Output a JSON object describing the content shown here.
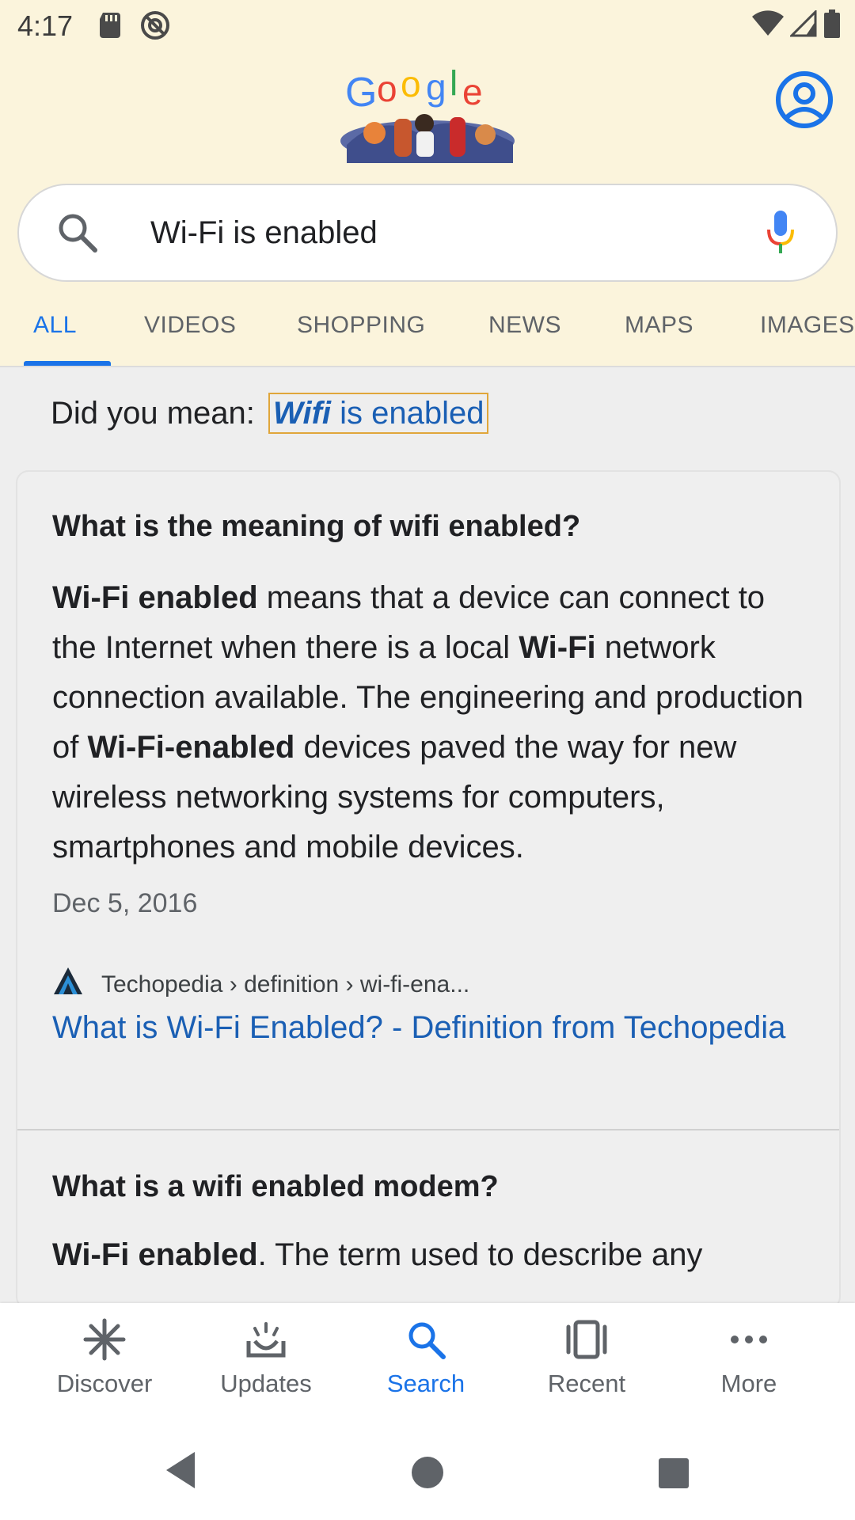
{
  "status_bar": {
    "time": "4:17"
  },
  "search": {
    "query": "Wi-Fi is enabled"
  },
  "tabs": [
    "ALL",
    "VIDEOS",
    "SHOPPING",
    "NEWS",
    "MAPS",
    "IMAGES"
  ],
  "active_tab": "ALL",
  "did_you_mean": {
    "label": "Did you mean:",
    "suggestion_bold": "Wifi",
    "suggestion_rest": " is enabled"
  },
  "result1": {
    "question": "What is the meaning of wifi enabled?",
    "seg1_b": "Wi-Fi enabled",
    "seg2": " means that a device can connect to the Internet when there is a local ",
    "seg3_b": "Wi-Fi",
    "seg4": " network connection available. The engineering and production of ",
    "seg5_b": "Wi-Fi-enabled",
    "seg6": " devices paved the way for new wireless networking systems for computers, smartphones and mobile devices.",
    "date": "Dec 5, 2016",
    "source": "Techopedia › definition › wi-fi-ena...",
    "link": "What is Wi-Fi Enabled? - Definition from Techopedia"
  },
  "result2": {
    "question": "What is a wifi enabled modem?",
    "seg1_b": "Wi-Fi enabled",
    "seg2": ". The term used to describe any"
  },
  "bottom_nav": {
    "discover": "Discover",
    "updates": "Updates",
    "search": "Search",
    "recent": "Recent",
    "more": "More"
  },
  "colors": {
    "accent": "#1a73e8",
    "header_bg": "#fbf4dc",
    "link": "#1a5fb4"
  }
}
